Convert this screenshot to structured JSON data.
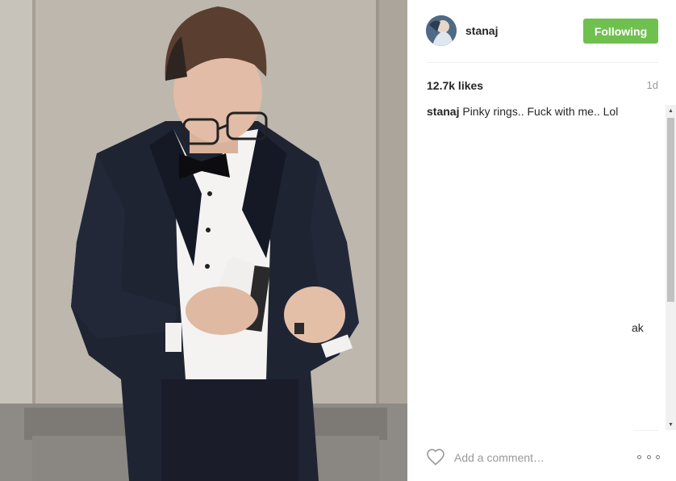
{
  "post": {
    "user": {
      "username": "stanaj",
      "avatar_icon": "profile-avatar"
    },
    "follow_button_label": "Following",
    "likes": "12.7k likes",
    "age": "1d",
    "caption": {
      "username": "stanaj",
      "text": "Pinky rings.. Fuck with me.. Lol"
    },
    "partial_text": "ak",
    "comment_placeholder": "Add a comment…",
    "icons": {
      "like": "heart-icon",
      "more": "more-options-icon"
    },
    "colors": {
      "follow_button": "#70c050",
      "muted_text": "#999999"
    }
  }
}
